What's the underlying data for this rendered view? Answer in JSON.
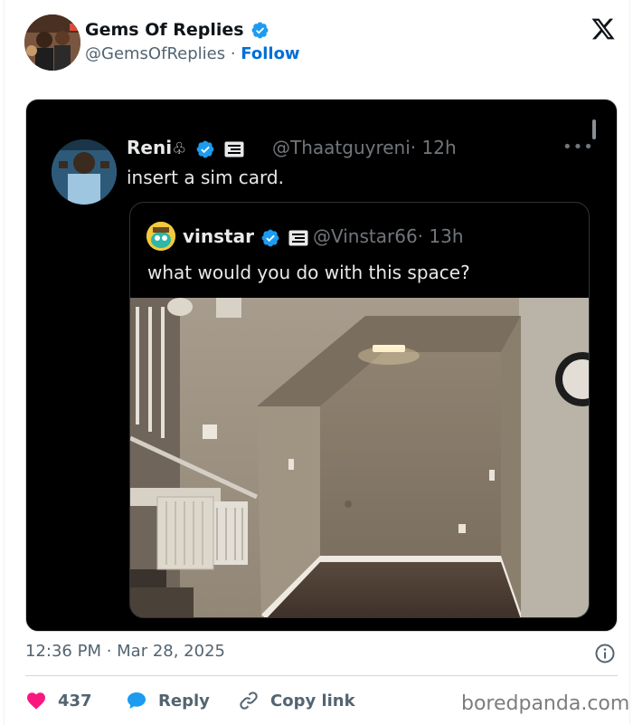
{
  "author": {
    "name": "Gems Of Replies",
    "handle": "@GemsOfReplies",
    "separator": "·",
    "follow_label": "Follow"
  },
  "embedded": {
    "post": {
      "name": "Reni",
      "handle": "@Thaatguyreni",
      "time": "· 12h",
      "text": "insert a sim card."
    },
    "quoted": {
      "name": "vinstar",
      "handle": "@Vinstar66",
      "time": "· 13h",
      "text": "what would you do with this space?"
    }
  },
  "footer": {
    "timestamp": "12:36 PM · Mar 28, 2025",
    "likes": "437",
    "reply_label": "Reply",
    "copy_link_label": "Copy link"
  },
  "watermark": "boredpanda.com",
  "colors": {
    "accent": "#1d9bf0",
    "like": "#f91880",
    "dark_bg": "#000000"
  },
  "icons": [
    "verified-badge-icon",
    "x-logo-icon",
    "info-icon",
    "heart-icon",
    "reply-icon",
    "link-icon",
    "more-icon"
  ]
}
